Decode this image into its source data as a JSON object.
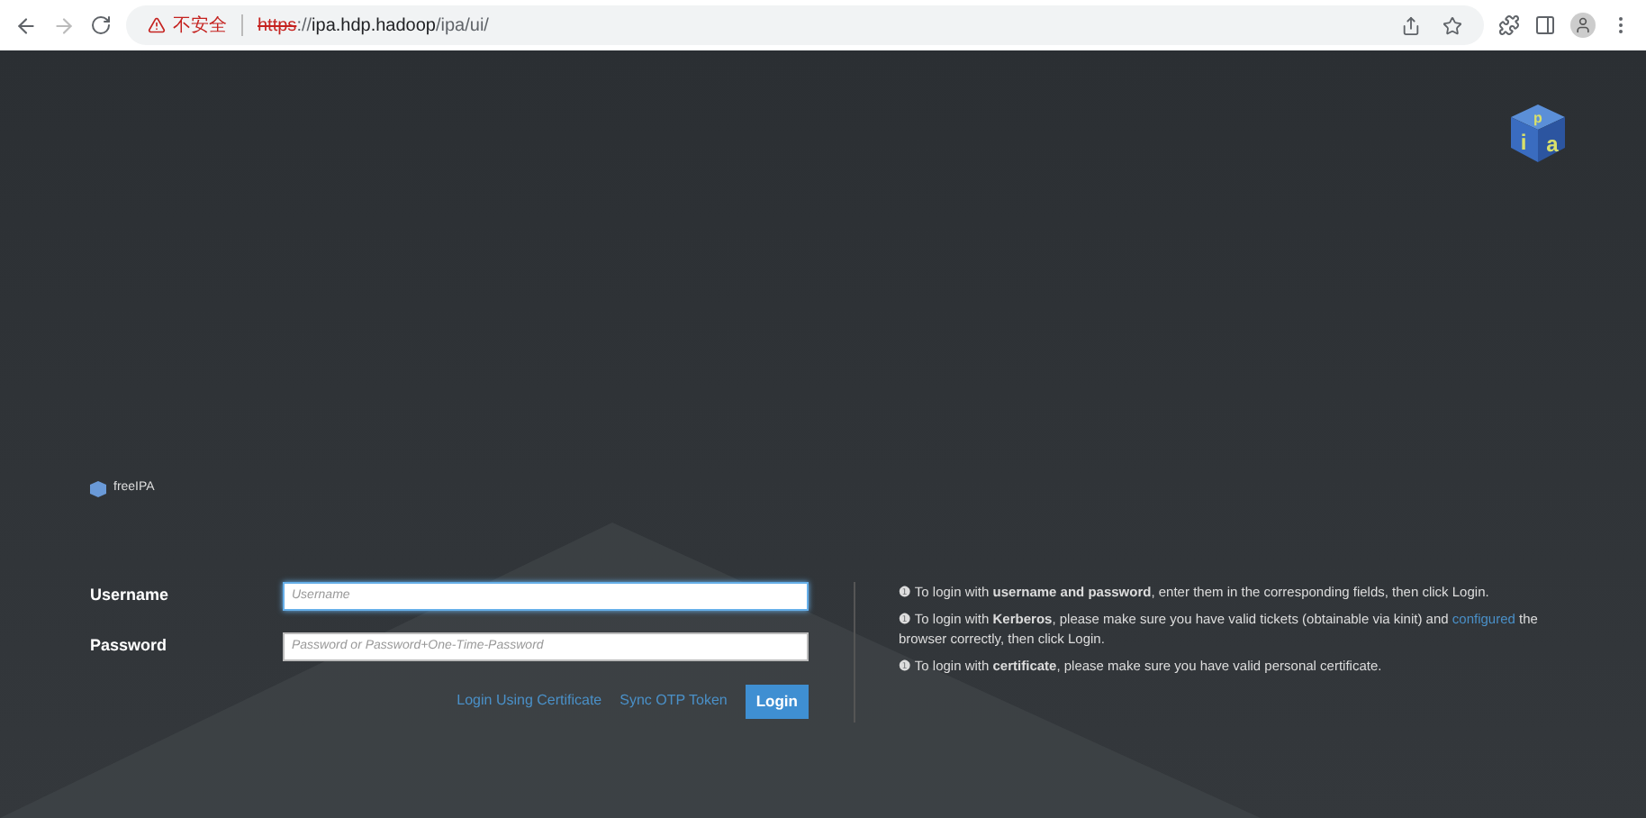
{
  "browser": {
    "security_label": "不安全",
    "url_scheme": "https",
    "url_separator": "://",
    "url_host": "ipa.hdp.hadoop",
    "url_path": "/ipa/ui/"
  },
  "logo": {
    "letters": [
      "p",
      "i",
      "a"
    ]
  },
  "brand": {
    "name": "freeIPA"
  },
  "form": {
    "fields": [
      {
        "label": "Username",
        "placeholder": "Username",
        "focused": true
      },
      {
        "label": "Password",
        "placeholder": "Password or Password+One-Time-Password",
        "focused": false
      }
    ],
    "links": [
      "Login Using Certificate",
      "Sync OTP Token"
    ],
    "button": "Login"
  },
  "help": [
    {
      "icon": "❶",
      "text": "To login with **username and password**, enter them in the corresponding fields, then click Login."
    },
    {
      "icon": "❶",
      "text": "To login with **Kerberos**, please make sure you have valid tickets (obtainable via kinit) and ",
      "link": "configured",
      "after": " the browser correctly, then click Login."
    },
    {
      "icon": "❶",
      "text": "To login with **certificate**, please make sure you have valid personal certificate."
    }
  ]
}
